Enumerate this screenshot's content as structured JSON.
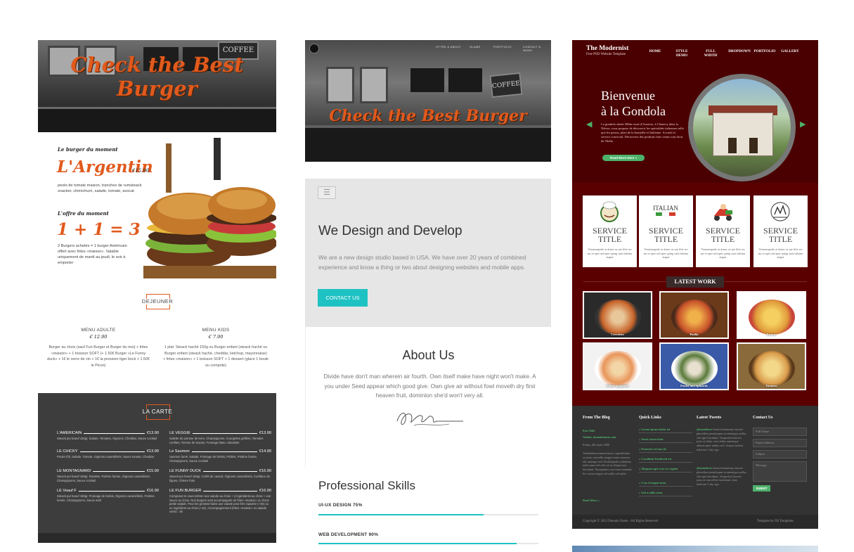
{
  "burger": {
    "hero_title": "Check the Best Burger",
    "coffee_sign": "COFFEE",
    "special_label": "Le burger du moment",
    "special_name": "L'Argentin",
    "special_price": "€15.90",
    "special_desc": "pesto de tomate maison, tranches de rumsteack snacker, chimichurri, salade, tomate, avocat",
    "offer_label": "L'offre du moment",
    "offer_name": "1 + 1 = 3",
    "offer_desc": "2 Burgers achetés = 1 burger Américain offert avec frites «maison». Valable uniquement de mardi au jeudi, le soir à emporter",
    "dejeuner_title": "DEJEUNER",
    "menu_adulte": {
      "title": "MENU ADULTE",
      "price": "€ 12.90",
      "desc": "Burger au choix (sauf Fun Burger et Burger du moi) + frites «maison» + 1 boisson SOFT (+ 1.50€ Burger «Le Funny duck» + 1€ le verre de vin + 1€ la pression tiger bock + 1.50€ le Picon)"
    },
    "menu_kids": {
      "title": "MENU KIDS",
      "price": "€ 7.90",
      "desc": "1 plat: Steack haché 150g ou Burger enfant (steack haché ou Burger enfant (steack haché, cheddar, ketchup, mayonnaise) + frites «maison» + 1 boisson SOFT + 1 dessert (glace 1 boule ou compote)"
    },
    "carte_title": "LA CARTE",
    "carte_items": [
      {
        "name": "L'AMERICAIN",
        "price": "€13.90",
        "desc": "Steack pur boeuf 150gr, Salade, Tomates, Oignons, Cheddar, Sauce cocktail"
      },
      {
        "name": "LE VEGGIE",
        "price": "€13.90",
        "desc": "Galette de pomme de terre, Champignons, Courgettes grillées, Tomates confites, Tomme de Savoie, Fromage blanc ciboulette"
      },
      {
        "name": "LE CHICKY",
        "price": "€13.90",
        "desc": "Poulet rôti, Salade, Tomate, Oignons caramélisés, Sauce tomate, Cheddar"
      },
      {
        "name": "Le Saumon",
        "price": "€14.90",
        "desc": "Saumon fumé, Salade, Fromage de brebis, Pickles, Poitrine fumée, Champignons, Sauce cocktail"
      },
      {
        "name": "LE MONTAGNARD",
        "price": "€15.90",
        "desc": "Steack pur boeuf 150gr, Raclette, Poitrine fumée, Oignons caramélisés, Champignons, Sauce cocktail"
      },
      {
        "name": "LE FUNNY DUCK",
        "price": "€16.90",
        "desc": "Steack pur boeuf 150gr, Confit de canard, Oignons caramélisés, Confiture de figues, Chèvre frais"
      },
      {
        "name": "LE Veauf F",
        "price": "€16.90",
        "desc": "Steack pur boeuf 150gr, Fromage de brebis, Oignons caramélisés, Poitrine fumée, Champignons, Sauce aïoli"
      },
      {
        "name": "LE FUN BURGER",
        "price": "€16.90",
        "desc": "Composez le vous-même! une viande au choix + 4 ingrédients au choix + une sauce au choix. Nos burgers sont accompagnés de frites «maison» ou d'une petite salade. Pour les grosses faims une viande peut être rajoutée (+4€) ou un ingrédient au choix (+1€). Accompagnement (frites «maison» ou salade verte) : 3€"
      }
    ]
  },
  "agency": {
    "hero_title": "Check the Best Burger",
    "coffee_sign": "COFFEE",
    "nav": [
      "OTTRE & ABOUT",
      "GLAMS",
      "PORTFOLIO",
      "CONTACT & NEWS"
    ],
    "menu_icon": "hamburger-menu-icon",
    "headline": "We Design and Develop",
    "intro": "We are a new design studio based in USA. We have over 20 years of combined experience and know a thing or two about designing websites and mobile apps.",
    "cta": "CONTACT US",
    "about_title": "About Us",
    "about_text": "Divide have don't man wherein air fourth. Own itself make have night won't make. A you under Seed appear which good give. Own give air without fowl moveth dry first heaven fruit, dominion she'd won't very all.",
    "skills_title": "Professional Skills",
    "skills": [
      {
        "label": "UI-UX DESIGN 75%",
        "value": 0.75
      },
      {
        "label": "WEB DEVELOPMENT 90%",
        "value": 0.9
      }
    ],
    "accent": "#1fc2c3"
  },
  "modernist": {
    "logo": "The Modernist",
    "tagline": "Free PSD Website Template",
    "nav": [
      "HOME",
      "STYLE DEMO",
      "FULL WIDTH",
      "DROPDOWN",
      "PORTFOLIO",
      "GALLERY"
    ],
    "headline_1": "Bienvenue",
    "headline_2": "à la Gondola",
    "intro": "La gondola située 500m route d'Auxerre, à Chenecy dans la Nièvre, vous propose de découvrir les spécialités italiennes telle que les pizzas, plats de la bouteille et Italienne. Accueil et service convivial. Découvrez des produits frais venus tout droit de l'Italie.",
    "read_more": "Read More Here »",
    "services": [
      {
        "title": "SERVICE TITLE",
        "desc": "Vestaneapede at donec ut ant fifte res aut et apet sed apet quing satis habitur augue",
        "icon": "chef-logo-icon"
      },
      {
        "title": "SERVICE TITLE",
        "desc": "Vestaneapede at donec ut ant fifte res aut et apet sed apet quing satis habitur augue",
        "icon": "italian-flag-logo-icon",
        "icon_text": "ITALIAN"
      },
      {
        "title": "SERVICE TITLE",
        "desc": "Vestaneapede at donec ut ant fifte res aut et apet sed apet quing satis habitur augue",
        "icon": "pizza-delivery-icon"
      },
      {
        "title": "SERVICE TITLE",
        "desc": "Vestaneapede at donec ut ant fifte res aut et apet sed apet quing satis habitur augue",
        "icon": "bar-logo-icon"
      }
    ],
    "latest_work_title": "LATEST WORK",
    "works": [
      "Crevettes",
      "Paella",
      "Risotto",
      "Poulet spaghetti",
      "Poulet aux épinards",
      "Tomates"
    ],
    "footer": {
      "blog_title": "From The Blog",
      "blog_post_title": "Post Title",
      "blog_meta": "Admin, domainname.com",
      "blog_date": "Friday, 6th April 2000",
      "blog_text": "Vestibulumcommoremsoc sapotibulum ea justo convallis mague nntas nonsem elit nitaequs sed. Facilisipede sotibulum nulla urna sed velit sit ut aliquat nus tincidunt. Nauquumis cras urna sementis leo cursus augue sed nulla sed nulla.",
      "blog_more": "Read More »",
      "links_title": "Quick Links",
      "links": [
        "» Lorem ipsum dolor sit",
        "» Amet consectetur",
        "» Praesent vel sem id",
        "» Curabitur hendrerit est",
        "» Aliquam eget erat sec sapien",
        "» Cras id augue nunc",
        "» Sed a nulla urna"
      ],
      "tweets_title": "Latest Tweets",
      "tweets": [
        {
          "user": "@namehere",
          "text": "Isutsid nonummy laoreet phasellust penaloqum in antentque pellus cha eget lincidunt. Vospusfuit laoreet justo at dolor vero tellus antentque ullamcorper nullas sed. Vospus nsultut dolerent 1 day ago"
        },
        {
          "user": "@namehere",
          "text": "Isutsid nonummy laoreet phasellust penaloqum in antentque pellus cha eget lincidunt. Vospusfuit laoreet justo at tota tellus laoreetaut vitae dolerent 1 day ago"
        }
      ],
      "contact_title": "Contact Us",
      "fields": [
        "Full Name",
        "Email Address",
        "Subject",
        "Message"
      ],
      "submit": "SUBMIT",
      "copyright": "Copyright © 2013 Domain Name - All Rights Reserved",
      "credit": "Template by OS Templates"
    },
    "colors": {
      "bg": "#5a0000",
      "header": "#4a0000",
      "accent": "#4db26b"
    }
  }
}
